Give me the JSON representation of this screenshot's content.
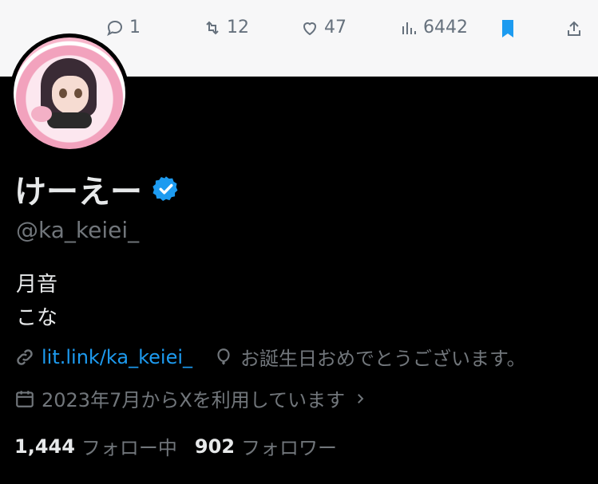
{
  "engagement": {
    "replies": "1",
    "reposts": "12",
    "likes": "47",
    "views": "6442"
  },
  "profile": {
    "display_name": "けーえー",
    "handle": "@ka_keiei_",
    "bio_line1": "月音",
    "bio_line2": "こな",
    "link": "lit.link/ka_keiei_",
    "birthday_text": "お誕生日おめでとうございます。",
    "joined_text": "2023年7月からXを利用しています",
    "following_count": "1,444",
    "following_label": "フォロー中",
    "followers_count": "902",
    "followers_label": "フォロワー"
  },
  "colors": {
    "accent": "#1d9bf0",
    "muted": "#71767b",
    "text": "#e7e9ea"
  }
}
